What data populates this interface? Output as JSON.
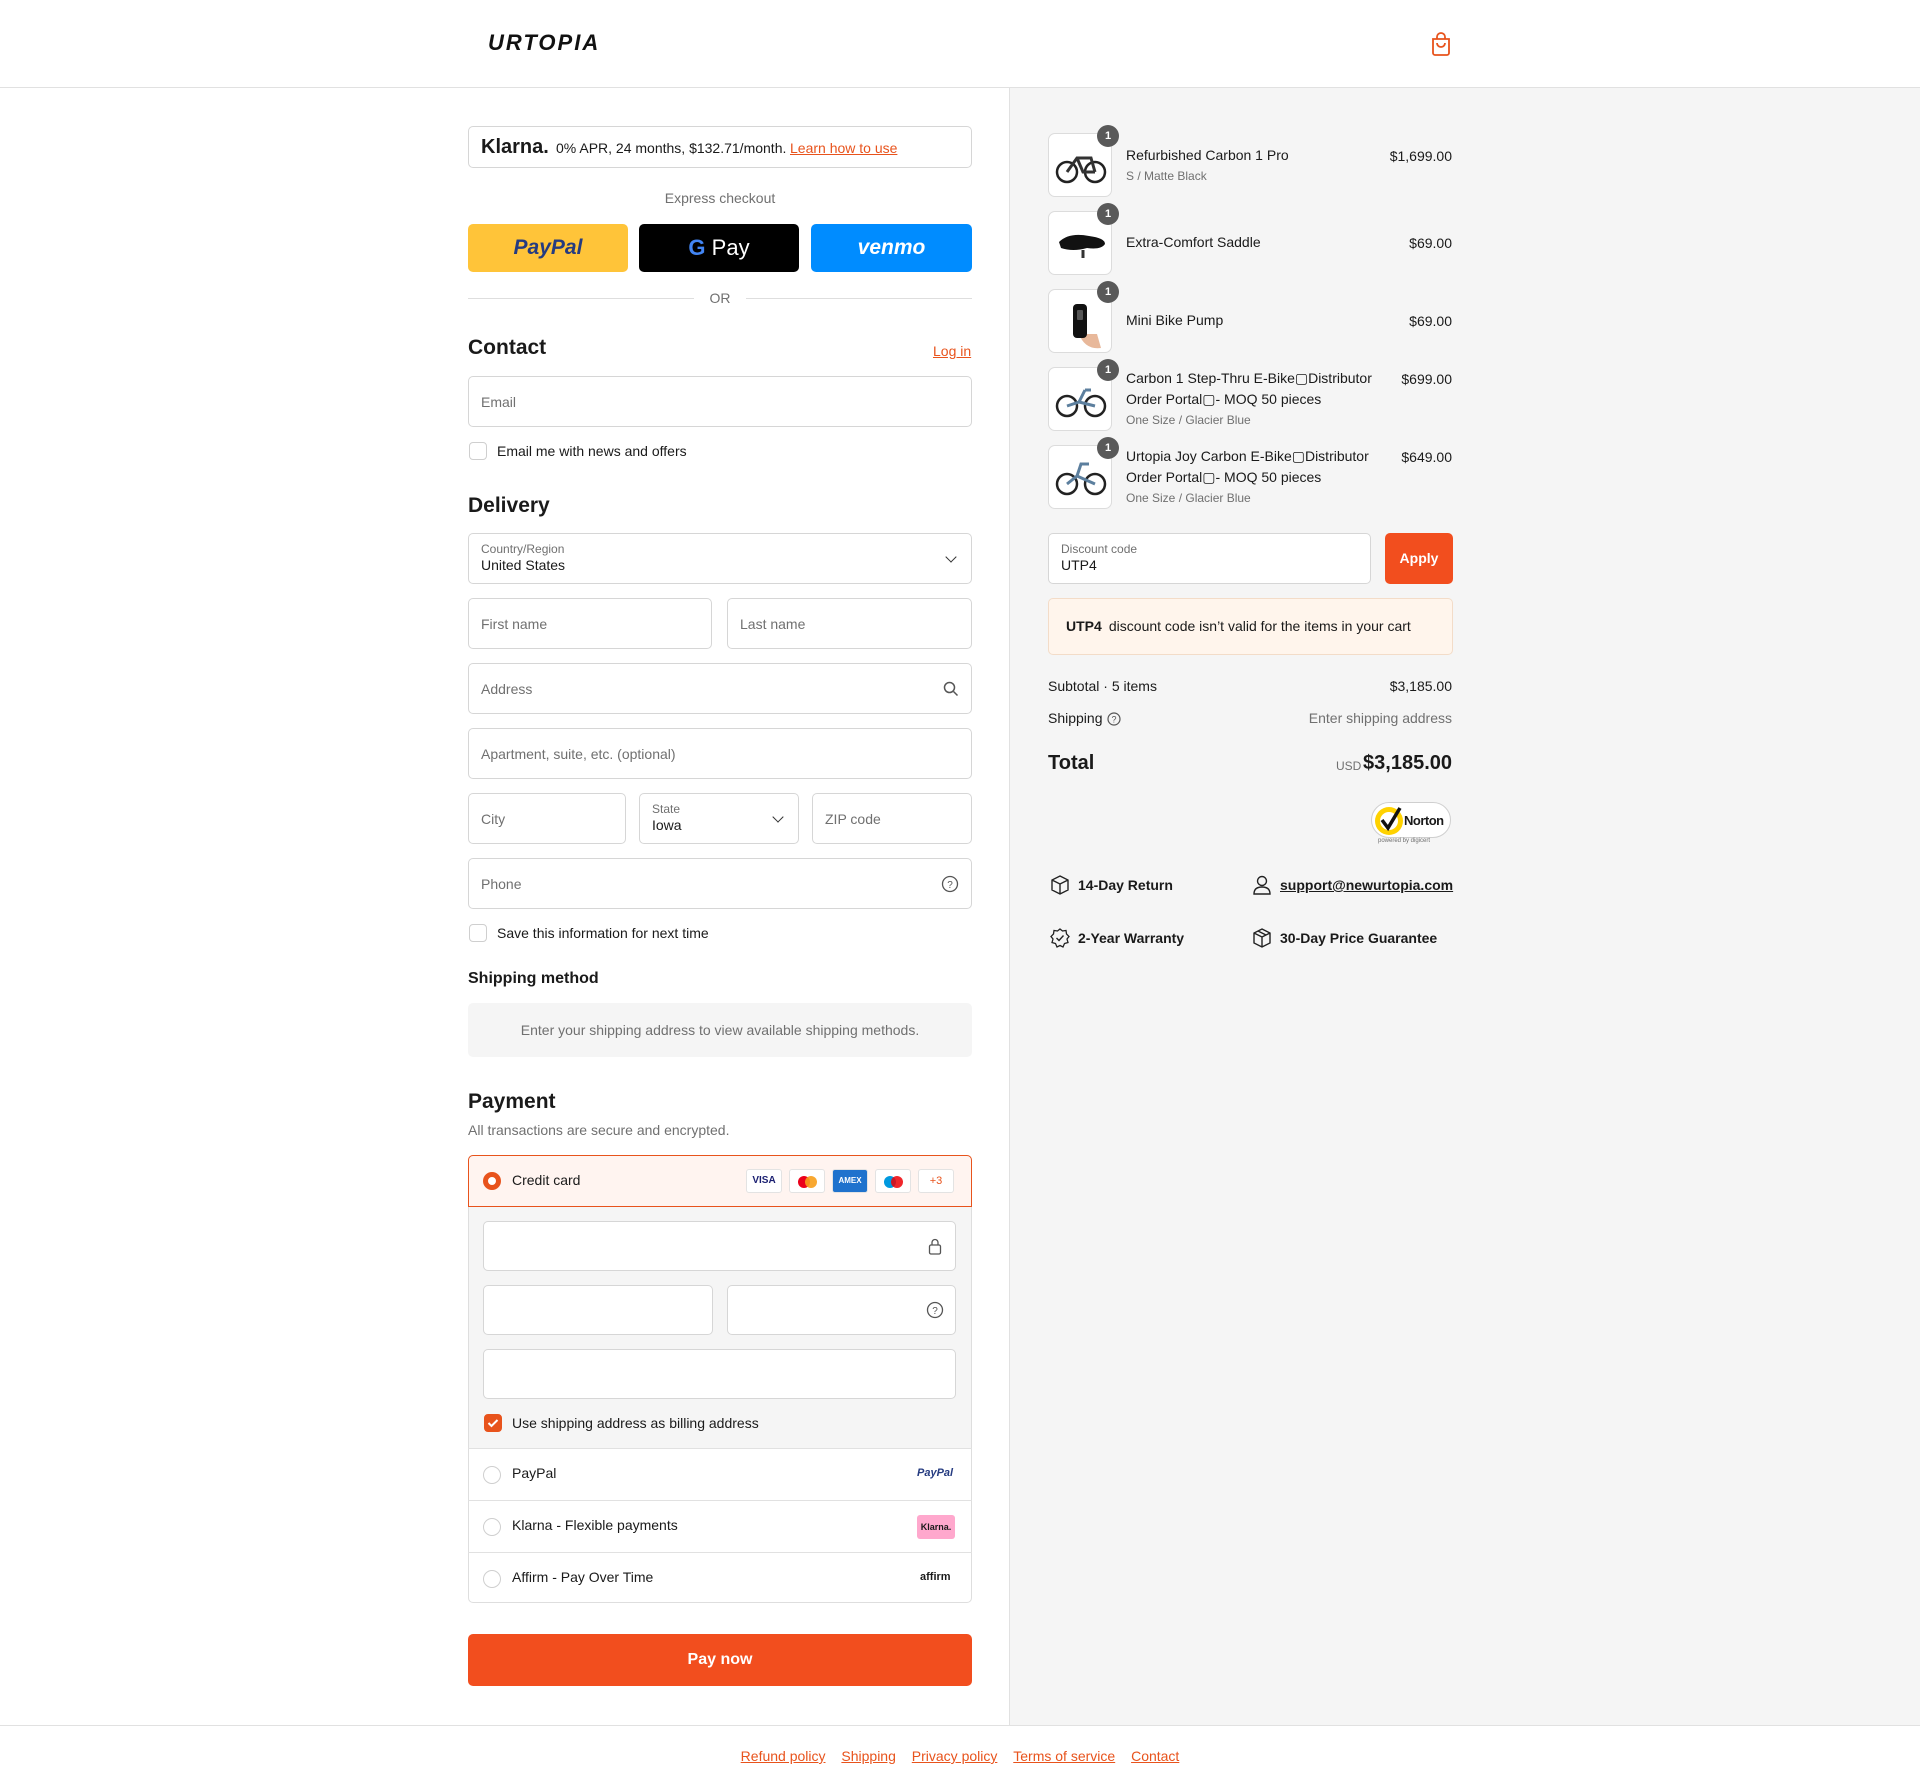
{
  "header": {
    "logo": "URTOPIA"
  },
  "klarna": {
    "brand": "Klarna.",
    "text": "0% APR, 24 months, $132.71/month.",
    "link": "Learn how to use"
  },
  "express": {
    "title": "Express checkout",
    "paypal": "PayPal",
    "gpay": "Pay",
    "venmo": "venmo",
    "or": "OR"
  },
  "contact": {
    "title": "Contact",
    "login": "Log in",
    "email_placeholder": "Email",
    "newsletter": "Email me with news and offers"
  },
  "delivery": {
    "title": "Delivery",
    "country_label": "Country/Region",
    "country_value": "United States",
    "first_name": "First name",
    "last_name": "Last name",
    "address": "Address",
    "apartment": "Apartment, suite, etc. (optional)",
    "city": "City",
    "state_label": "State",
    "state_value": "Iowa",
    "zip": "ZIP code",
    "phone": "Phone",
    "save_info": "Save this information for next time"
  },
  "shipping_method": {
    "title": "Shipping method",
    "message": "Enter your shipping address to view available shipping methods."
  },
  "payment": {
    "title": "Payment",
    "subtitle": "All transactions are secure and encrypted.",
    "credit_card": "Credit card",
    "card_logos": [
      "VISA",
      "MC",
      "AMEX",
      "MAESTRO",
      "+3"
    ],
    "billing": "Use shipping address as billing address",
    "paypal": "PayPal",
    "paypal_logo": "PayPal",
    "klarna": "Klarna - Flexible payments",
    "klarna_logo": "Klarna.",
    "affirm": "Affirm - Pay Over Time",
    "affirm_logo": "affirm",
    "pay_now": "Pay now"
  },
  "cart": {
    "items": [
      {
        "qty": "1",
        "name": "Refurbished Carbon 1 Pro",
        "variant": "S / Matte Black",
        "price": "$1,699.00"
      },
      {
        "qty": "1",
        "name": "Extra-Comfort Saddle",
        "variant": "",
        "price": "$69.00"
      },
      {
        "qty": "1",
        "name": "Mini Bike Pump",
        "variant": "",
        "price": "$69.00"
      },
      {
        "qty": "1",
        "name": "Carbon 1 Step-Thru E-Bike▢Distributor Order Portal▢- MOQ 50 pieces",
        "variant": "One Size / Glacier Blue",
        "price": "$699.00"
      },
      {
        "qty": "1",
        "name": "Urtopia Joy Carbon E-Bike▢Distributor Order Portal▢- MOQ 50 pieces",
        "variant": "One Size / Glacier Blue",
        "price": "$649.00"
      }
    ],
    "discount_label": "Discount code",
    "discount_value": "UTP4",
    "apply": "Apply",
    "error_code": "UTP4",
    "error_text": " discount code isn’t valid for the items in your cart",
    "subtotal_label": "Subtotal · 5 items",
    "subtotal": "$3,185.00",
    "shipping_label": "Shipping",
    "shipping_value": "Enter shipping address",
    "total_label": "Total",
    "currency": "USD",
    "total": "$3,185.00",
    "norton": "Norton",
    "norton_sub": "powered by digicert"
  },
  "features": {
    "return": "14-Day Return",
    "support": "support@newurtopia.com",
    "warranty": "2-Year Warranty",
    "price": "30-Day Price Guarantee"
  },
  "footer": {
    "refund": "Refund policy",
    "shipping": "Shipping",
    "privacy": "Privacy policy",
    "terms": "Terms of service",
    "contact": "Contact"
  },
  "colors": {
    "accent": "#e8531c",
    "paypal_yellow": "#ffc439",
    "venmo_blue": "#008cff"
  }
}
